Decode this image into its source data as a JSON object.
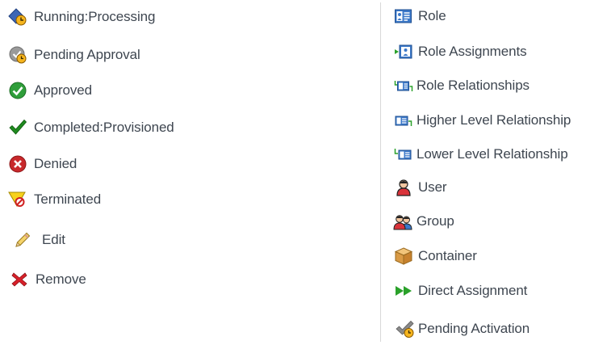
{
  "status_legend": [
    {
      "icon": "running-processing-icon",
      "label": "Running:Processing"
    },
    {
      "icon": "pending-approval-icon",
      "label": "Pending Approval"
    },
    {
      "icon": "approved-icon",
      "label": "Approved"
    },
    {
      "icon": "completed-provisioned-icon",
      "label": "Completed:Provisioned"
    },
    {
      "icon": "denied-icon",
      "label": "Denied"
    },
    {
      "icon": "terminated-icon",
      "label": "Terminated"
    },
    {
      "icon": "edit-icon",
      "label": "Edit"
    },
    {
      "icon": "remove-icon",
      "label": "Remove"
    }
  ],
  "type_legend": [
    {
      "icon": "role-icon",
      "label": "Role"
    },
    {
      "icon": "role-assignments-icon",
      "label": "Role Assignments"
    },
    {
      "icon": "role-relationships-icon",
      "label": "Role Relationships"
    },
    {
      "icon": "higher-level-relationship-icon",
      "label": "Higher Level Relationship"
    },
    {
      "icon": "lower-level-relationship-icon",
      "label": "Lower Level Relationship"
    },
    {
      "icon": "user-icon",
      "label": "User"
    },
    {
      "icon": "group-icon",
      "label": "Group"
    },
    {
      "icon": "container-icon",
      "label": "Container"
    },
    {
      "icon": "direct-assignment-icon",
      "label": "Direct Assignment"
    },
    {
      "icon": "pending-activation-icon",
      "label": "Pending Activation"
    }
  ],
  "colors": {
    "text": "#3e4650",
    "divider": "#d8d8d8",
    "approved_green": "#2f9e3a",
    "denied_red": "#c8282b",
    "role_blue": "#3b78c9",
    "arrow_green": "#2aa12a"
  }
}
